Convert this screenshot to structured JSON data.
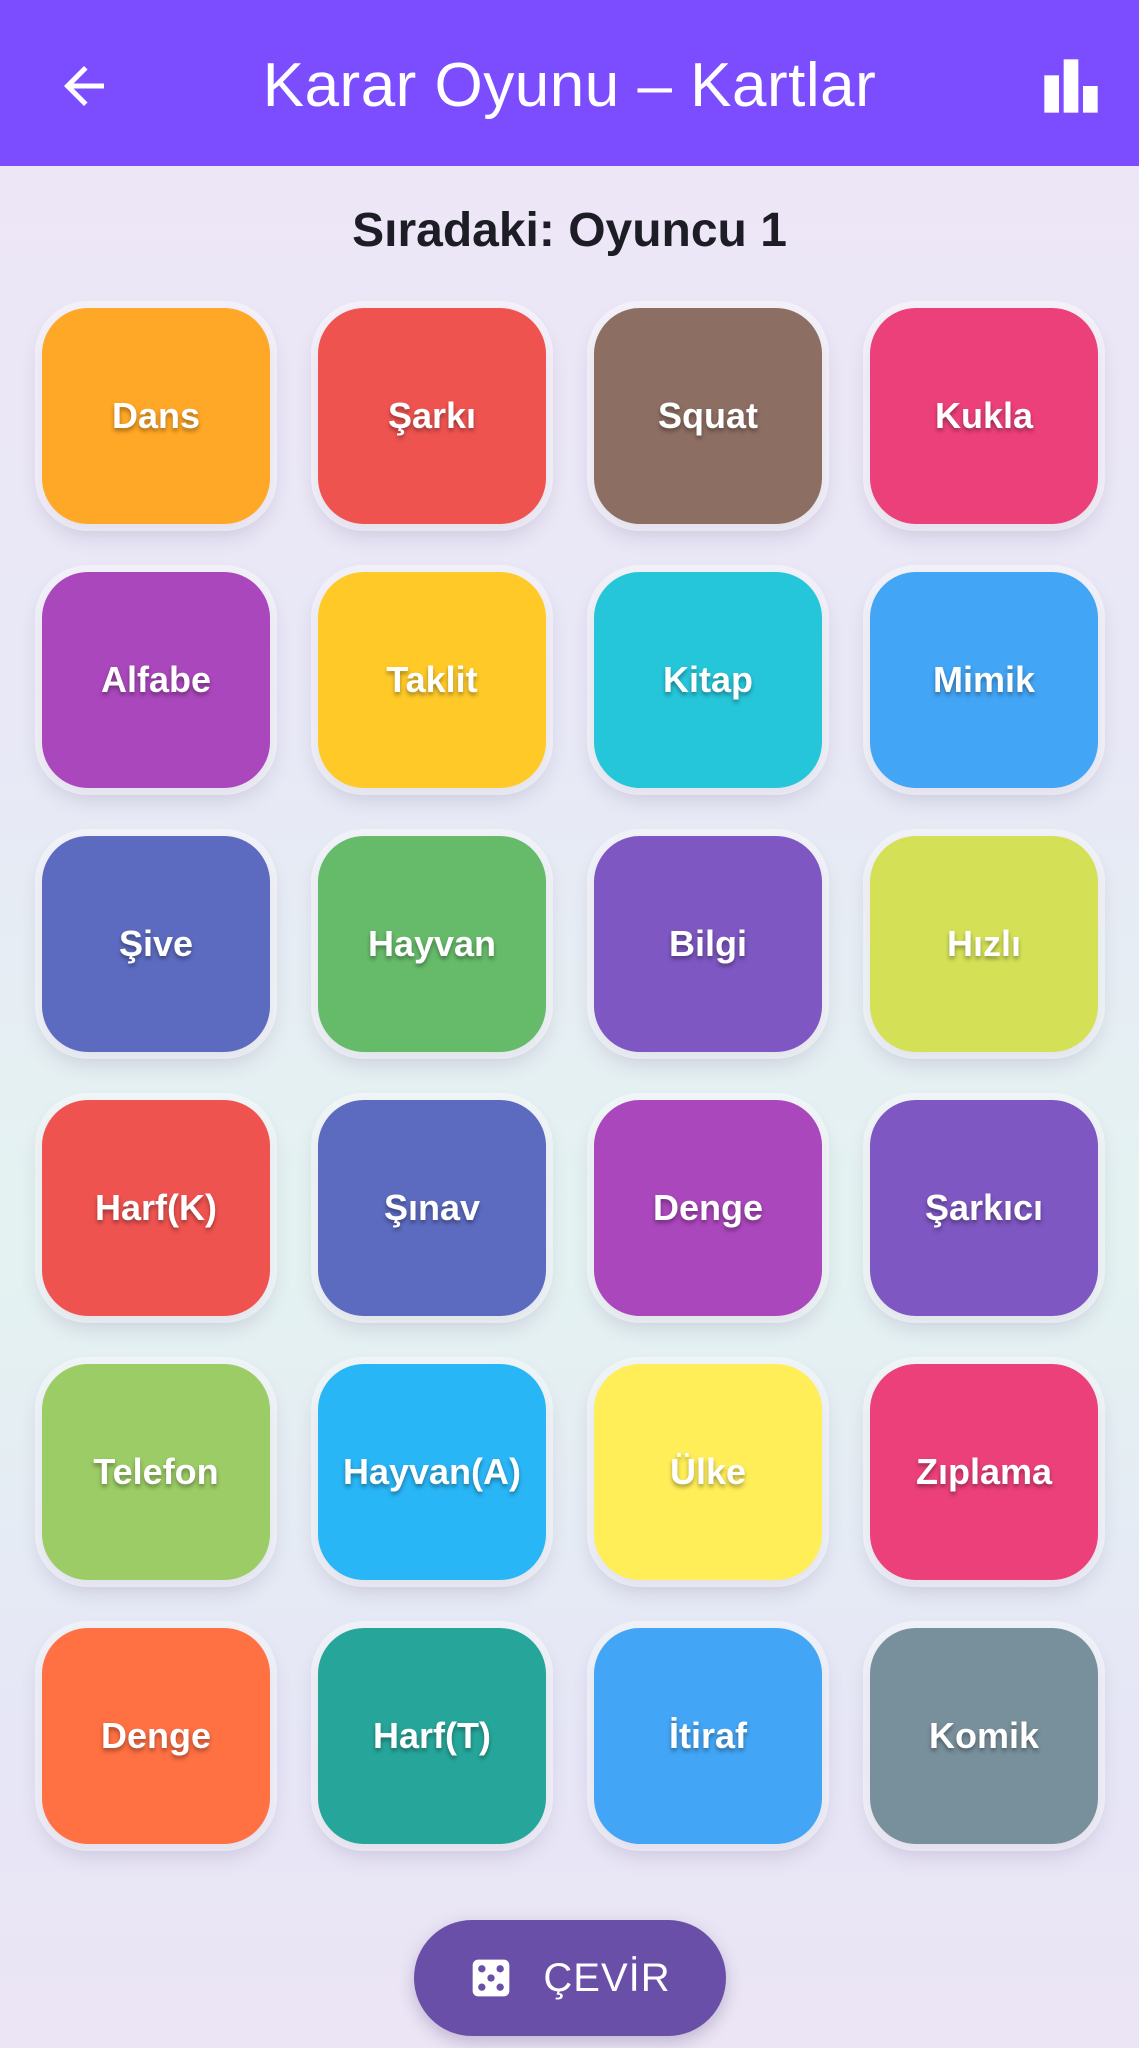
{
  "appbar": {
    "title": "Karar Oyunu – Kartlar",
    "color": "#7c4dff",
    "back_icon": "arrow-left-icon",
    "stats_icon": "bar-chart-icon"
  },
  "turn_label": "Sıradaki: Oyuncu 1",
  "cards": [
    {
      "label": "Dans",
      "color": "#ffa726"
    },
    {
      "label": "Şarkı",
      "color": "#ef5350"
    },
    {
      "label": "Squat",
      "color": "#8d6e63"
    },
    {
      "label": "Kukla",
      "color": "#ec407a"
    },
    {
      "label": "Alfabe",
      "color": "#ab47bc"
    },
    {
      "label": "Taklit",
      "color": "#ffca28"
    },
    {
      "label": "Kitap",
      "color": "#26c6da"
    },
    {
      "label": "Mimik",
      "color": "#42a5f5"
    },
    {
      "label": "Şive",
      "color": "#5c6bc0"
    },
    {
      "label": "Hayvan",
      "color": "#66bb6a"
    },
    {
      "label": "Bilgi",
      "color": "#7e57c2"
    },
    {
      "label": "Hızlı",
      "color": "#d4e157"
    },
    {
      "label": "Harf(K)",
      "color": "#ef5350"
    },
    {
      "label": "Şınav",
      "color": "#5c6bc0"
    },
    {
      "label": "Denge",
      "color": "#ab47bc"
    },
    {
      "label": "Şarkıcı",
      "color": "#7e57c2"
    },
    {
      "label": "Telefon",
      "color": "#9ccc65"
    },
    {
      "label": "Hayvan(A)",
      "color": "#29b6f6"
    },
    {
      "label": "Ülke",
      "color": "#ffee58"
    },
    {
      "label": "Zıplama",
      "color": "#ec407a"
    },
    {
      "label": "Denge",
      "color": "#ff7043"
    },
    {
      "label": "Harf(T)",
      "color": "#26a69a"
    },
    {
      "label": "İtiraf",
      "color": "#42a5f5"
    },
    {
      "label": "Komik",
      "color": "#78909c"
    }
  ],
  "spin_button": {
    "label": "ÇEVİR",
    "icon": "dice-icon",
    "color": "#6a4fa8"
  }
}
